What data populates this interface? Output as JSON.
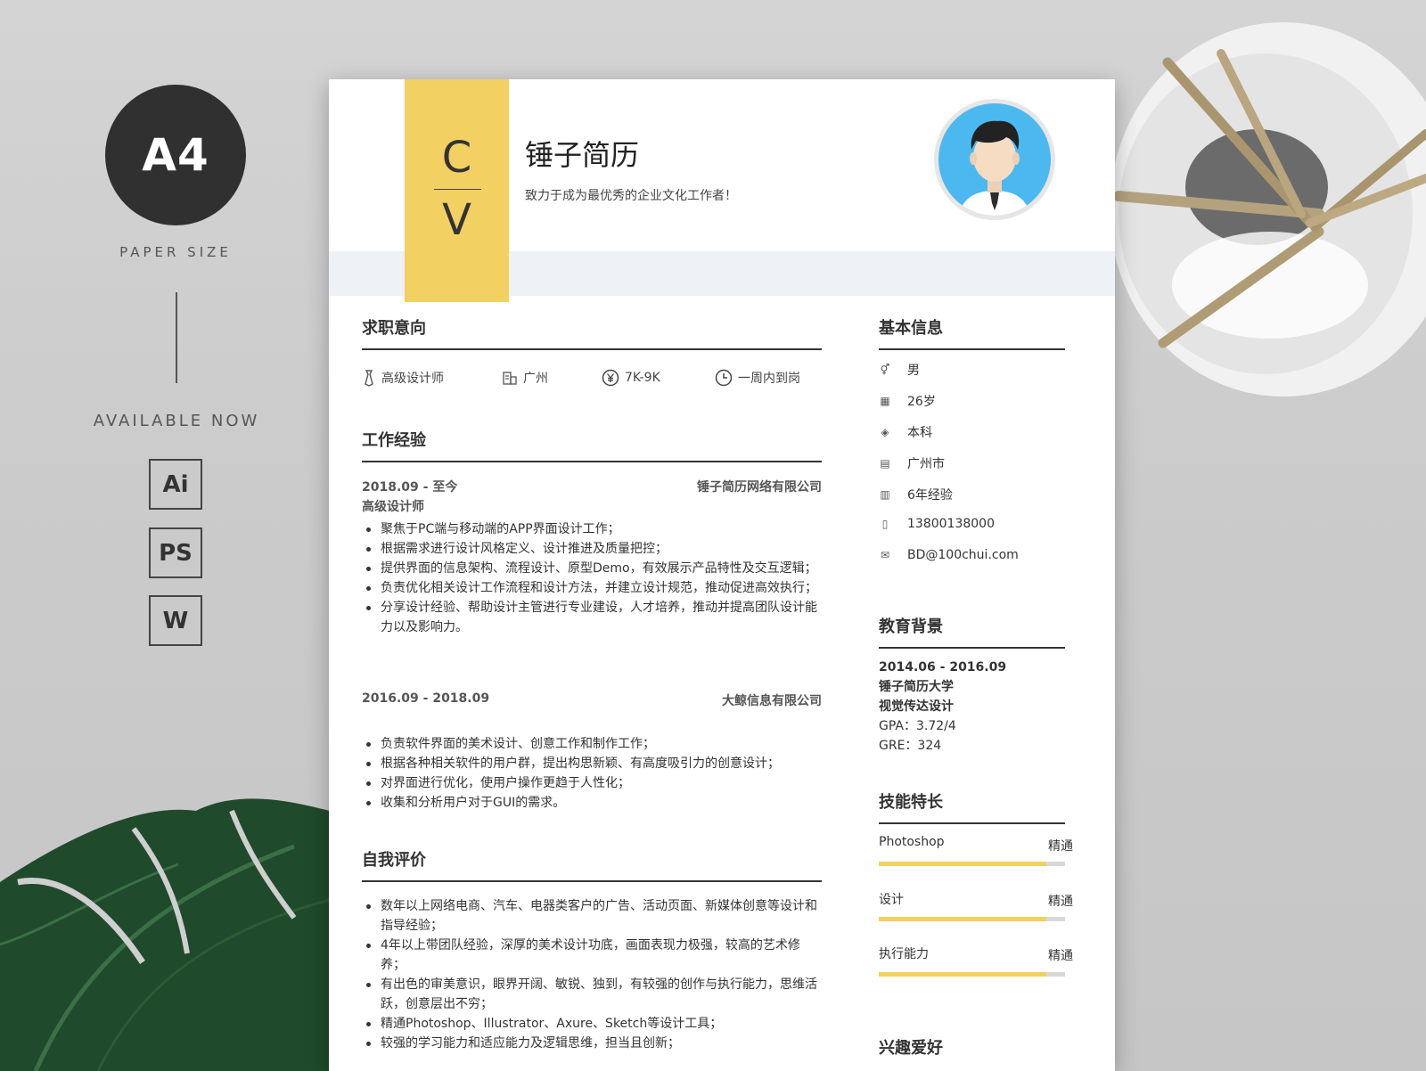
{
  "promo": {
    "paper_badge": "A4",
    "paper_size_label": "PAPER SIZE",
    "available_label": "AVAILABLE NOW",
    "formats": [
      "Ai",
      "PS",
      "W"
    ]
  },
  "header": {
    "cv_letter_top": "C",
    "cv_letter_bottom": "V",
    "name": "锤子简历",
    "tagline": "致力于成为最优秀的企业文化工作者！"
  },
  "intent": {
    "title": "求职意向",
    "items": [
      {
        "icon": "tie-icon",
        "label": "高级设计师"
      },
      {
        "icon": "building-icon",
        "label": "广州"
      },
      {
        "icon": "yen-icon",
        "label": "7K-9K"
      },
      {
        "icon": "clock-icon",
        "label": "一周内到岗"
      }
    ]
  },
  "work": {
    "title": "工作经验",
    "jobs": [
      {
        "date": "2018.09 - 至今",
        "company": "锤子简历网络有限公司",
        "position": "高级设计师",
        "bullets": [
          "聚焦于PC端与移动端的APP界面设计工作；",
          "根据需求进行设计风格定义、设计推进及质量把控；",
          "提供界面的信息架构、流程设计、原型Demo，有效展示产品特性及交互逻辑；",
          "负责优化相关设计工作流程和设计方法，并建立设计规范，推动促进高效执行；",
          "分享设计经验、帮助设计主管进行专业建设，人才培养，推动并提高团队设计能力以及影响力。"
        ]
      },
      {
        "date": "2016.09 - 2018.09",
        "company": "大鲸信息有限公司",
        "position": "",
        "bullets": [
          "负责软件界面的美术设计、创意工作和制作工作；",
          "根据各种相关软件的用户群，提出构思新颖、有高度吸引力的创意设计；",
          "对界面进行优化，使用户操作更趋于人性化；",
          "收集和分析用户对于GUI的需求。"
        ]
      }
    ]
  },
  "self": {
    "title": "自我评价",
    "bullets": [
      "数年以上网络电商、汽车、电器类客户的广告、活动页面、新媒体创意等设计和指导经验；",
      "4年以上带团队经验，深厚的美术设计功底，画面表现力极强，较高的艺术修养；",
      "有出色的审美意识，眼界开阔、敏锐、独到，有较强的创作与执行能力，思维活跃，创意层出不穷；",
      "精通Photoshop、Illustrator、Axure、Sketch等设计工具；",
      "较强的学习能力和适应能力及逻辑思维，担当且创新；"
    ]
  },
  "basic": {
    "title": "基本信息",
    "rows": [
      {
        "icon": "gender-icon",
        "glyph": "⚥",
        "value": "男"
      },
      {
        "icon": "calendar-icon",
        "glyph": "▦",
        "value": "26岁"
      },
      {
        "icon": "graduation-cap-icon",
        "glyph": "◈",
        "value": "本科"
      },
      {
        "icon": "city-icon",
        "glyph": "▤",
        "value": "广州市"
      },
      {
        "icon": "document-icon",
        "glyph": "▥",
        "value": "6年经验"
      },
      {
        "icon": "phone-icon",
        "glyph": "▯",
        "value": "13800138000"
      },
      {
        "icon": "mail-icon",
        "glyph": "✉",
        "value": "BD@100chui.com"
      }
    ]
  },
  "education": {
    "title": "教育背景",
    "date": "2014.06 - 2016.09",
    "school": "锤子简历大学",
    "major": "视觉传达设计",
    "gpa": "GPA：3.72/4",
    "gre": "GRE：324"
  },
  "skills": {
    "title": "技能特长",
    "items": [
      {
        "name": "Photoshop",
        "level": "精通",
        "fill": 0.9
      },
      {
        "name": "设计",
        "level": "精通",
        "fill": 0.9
      },
      {
        "name": "执行能力",
        "level": "精通",
        "fill": 0.9
      }
    ]
  },
  "hobbies": {
    "title": "兴趣爱好"
  },
  "colors": {
    "accent": "#f2d062",
    "band": "#eef1f5",
    "avatar_ring": "#4cb8f0"
  }
}
